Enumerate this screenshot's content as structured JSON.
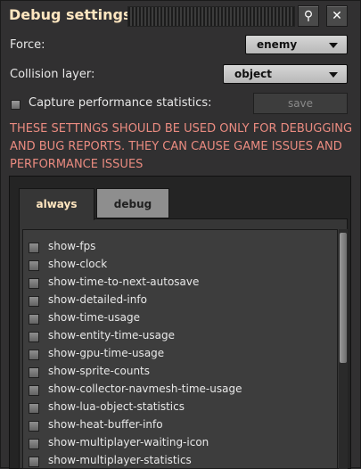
{
  "window": {
    "title": "Debug settings"
  },
  "titlebar": {
    "search_icon": "search-icon",
    "close_icon": "close-icon",
    "search_glyph": "⚲",
    "close_glyph": "✕"
  },
  "settings": {
    "force_label": "Force:",
    "force_value": "enemy",
    "collision_label": "Collision layer:",
    "collision_value": "object",
    "capture_label": "Capture performance statistics:",
    "capture_checked": false,
    "save_label": "save"
  },
  "warning": "THESE SETTINGS SHOULD BE USED ONLY FOR DEBUGGING AND BUG REPORTS. THEY CAN CAUSE GAME ISSUES AND PERFORMANCE ISSUES",
  "tabs": [
    {
      "label": "always",
      "active": true
    },
    {
      "label": "debug",
      "active": false
    }
  ],
  "options": [
    "show-fps",
    "show-clock",
    "show-time-to-next-autosave",
    "show-detailed-info",
    "show-time-usage",
    "show-entity-time-usage",
    "show-gpu-time-usage",
    "show-sprite-counts",
    "show-collector-navmesh-time-usage",
    "show-lua-object-statistics",
    "show-heat-buffer-info",
    "show-multiplayer-waiting-icon",
    "show-multiplayer-statistics"
  ],
  "colors": {
    "title": "#ffe6c0",
    "warning": "#ea8b80",
    "background": "#313031"
  }
}
